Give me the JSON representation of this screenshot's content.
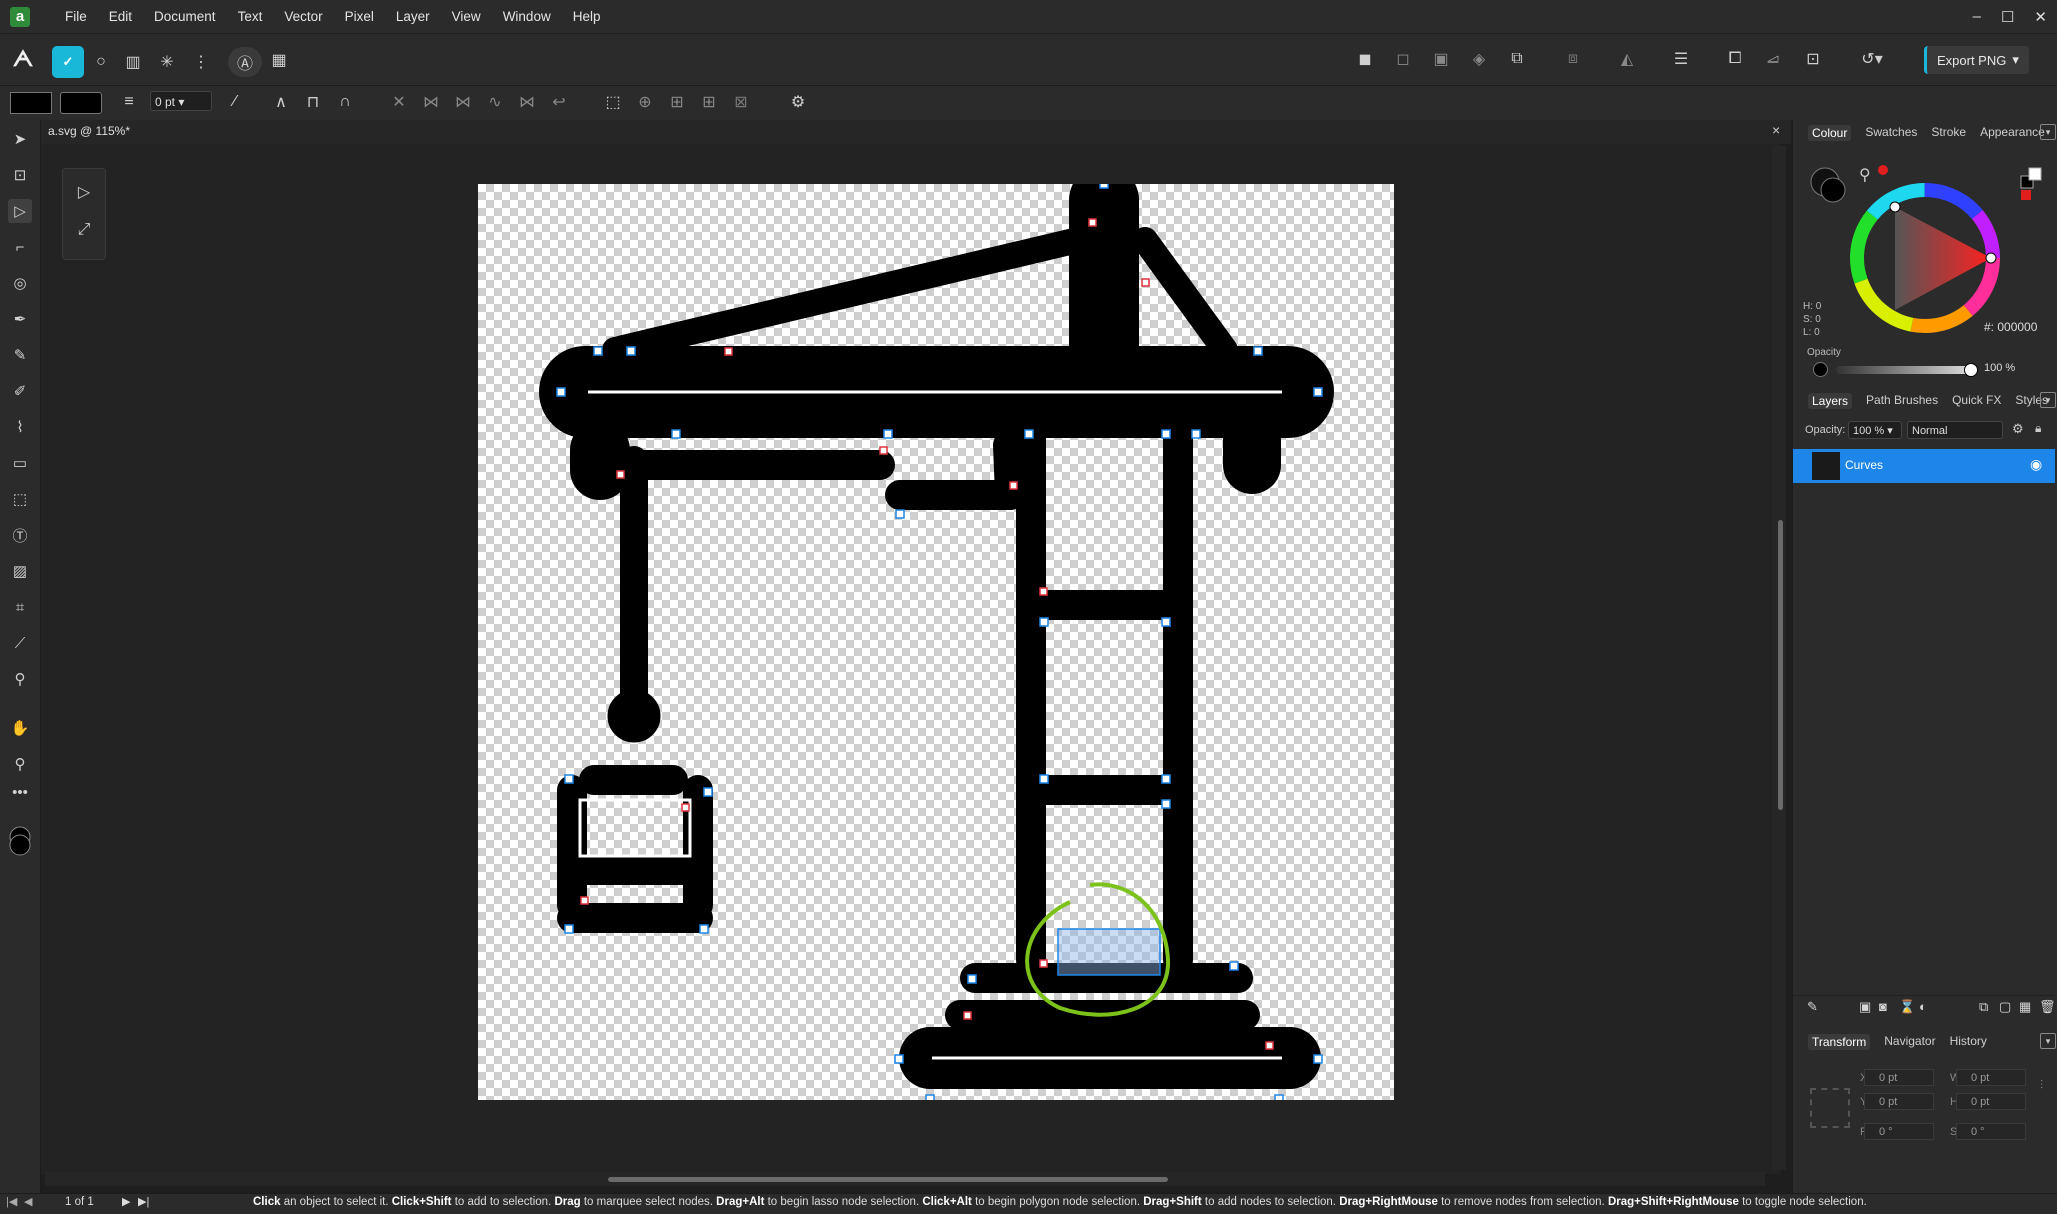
{
  "app": {
    "logo_letter": "a"
  },
  "menu": [
    "File",
    "Edit",
    "Document",
    "Text",
    "Vector",
    "Pixel",
    "Layer",
    "View",
    "Window",
    "Help"
  ],
  "window_controls": {
    "minimize": "–",
    "maximize": "☐",
    "close": "✕"
  },
  "toolbar": {
    "export_label": "Export PNG"
  },
  "context": {
    "stroke_width": "0 pt"
  },
  "document": {
    "title": "a.svg @ 115%*",
    "close": "×"
  },
  "colour_panel": {
    "tabs": [
      "Colour",
      "Swatches",
      "Stroke",
      "Appearance"
    ],
    "selected_tab": "Colour",
    "hsl": [
      "H: 0",
      "S: 0",
      "L: 0"
    ],
    "hex": "#: 000000",
    "opacity_label": "Opacity",
    "opacity_value": "100 %"
  },
  "layers_panel": {
    "tabs": [
      "Layers",
      "Path Brushes",
      "Quick FX",
      "Styles"
    ],
    "selected_tab": "Layers",
    "opacity_label": "Opacity:",
    "opacity_value": "100 %",
    "blend_mode": "Normal",
    "layers": [
      {
        "name": "Curves",
        "visible": true,
        "selected": true
      }
    ]
  },
  "transform_panel": {
    "tabs": [
      "Transform",
      "Navigator",
      "History"
    ],
    "selected_tab": "Transform",
    "fields": {
      "x": "0 pt",
      "y": "0 pt",
      "w": "0 pt",
      "h": "0 pt",
      "r": "0 °",
      "s": "0 °"
    },
    "labels": {
      "x": "X:",
      "y": "Y:",
      "w": "W:",
      "h": "H:",
      "r": "R:",
      "s": "S:"
    }
  },
  "status": {
    "page": "1 of 1",
    "hint_parts": [
      {
        "b": "Click",
        "t": " an object to select it. "
      },
      {
        "b": "Click+Shift",
        "t": " to add to selection. "
      },
      {
        "b": "Drag",
        "t": " to marquee select nodes. "
      },
      {
        "b": "Drag+Alt",
        "t": " to begin lasso node selection. "
      },
      {
        "b": "Click+Alt",
        "t": " to begin polygon node selection. "
      },
      {
        "b": "Drag+Shift",
        "t": " to add nodes to selection. "
      },
      {
        "b": "Drag+RightMouse",
        "t": " to remove nodes from selection. "
      },
      {
        "b": "Drag+Shift+RightMouse",
        "t": " to toggle node selection."
      }
    ]
  },
  "colors": {
    "accent": "#19b8d8",
    "selection": "#1e86e8",
    "annotation": "#7cc21b"
  }
}
